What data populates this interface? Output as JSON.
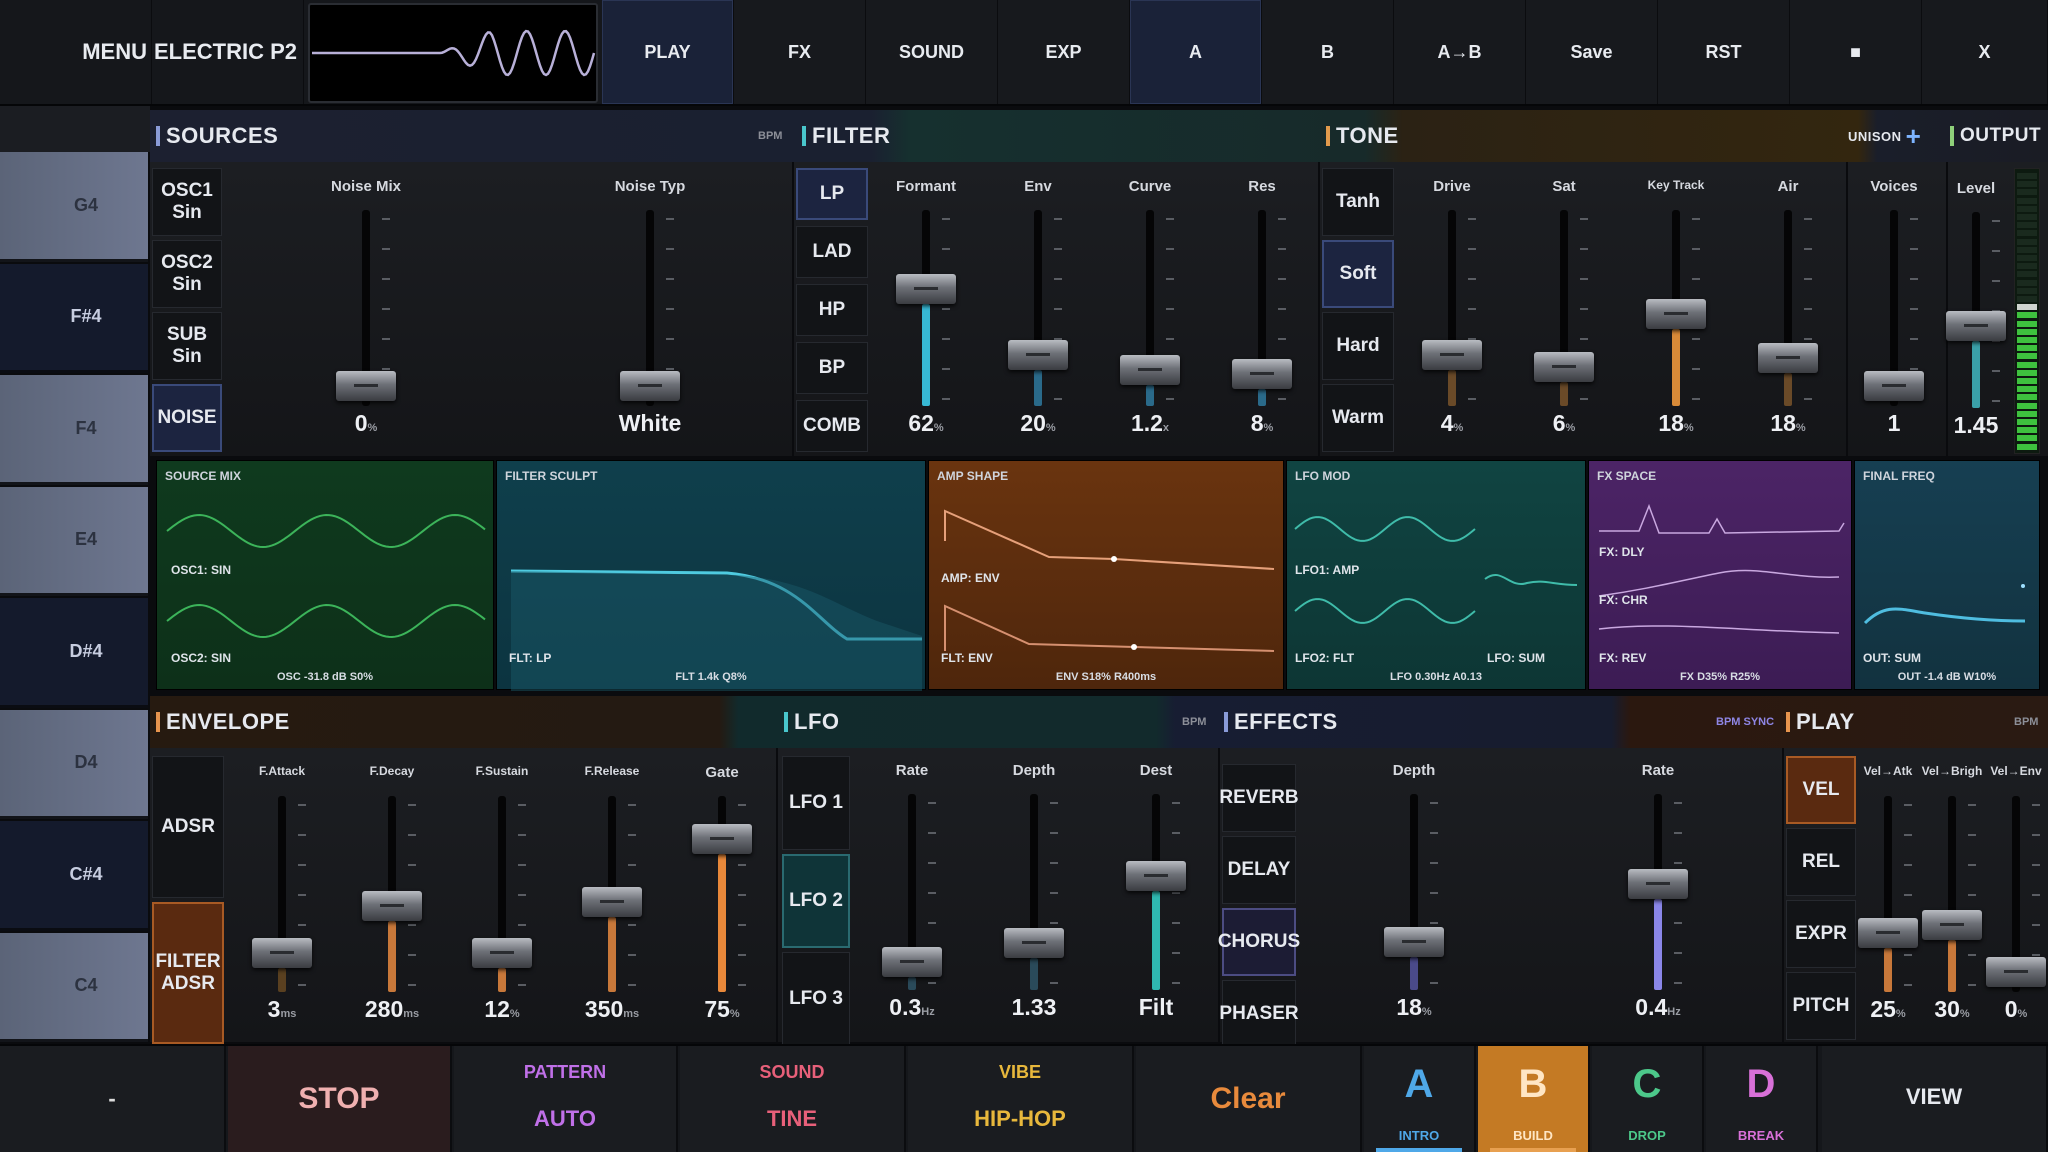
{
  "topbar": {
    "menu": "MENU",
    "preset": "ELECTRIC P2",
    "buttons": [
      "PLAY",
      "FX",
      "SOUND",
      "EXP",
      "A",
      "B",
      "A→B",
      "Save",
      "RST",
      "■",
      "X"
    ]
  },
  "keys": [
    "G4",
    "F#4",
    "F4",
    "E4",
    "D#4",
    "D4",
    "C#4",
    "C4"
  ],
  "sources": {
    "title": "SOURCES",
    "tag": "BPM",
    "buttons": [
      "OSC1 Sin",
      "OSC2 Sin",
      "SUB Sin",
      "NOISE"
    ],
    "sliders": [
      {
        "label": "Noise Mix",
        "value": "0",
        "unit": "%",
        "level": 0
      },
      {
        "label": "Noise Typ",
        "value": "White",
        "unit": "",
        "level": 0
      }
    ]
  },
  "filter": {
    "title": "FILTER",
    "modes": [
      "LP",
      "LAD",
      "HP",
      "BP",
      "COMB"
    ],
    "sliders": [
      {
        "label": "Formant",
        "value": "62",
        "unit": "%",
        "level": 0.62
      },
      {
        "label": "Env",
        "value": "20",
        "unit": "%",
        "level": 0.2
      },
      {
        "label": "Curve",
        "value": "1.2",
        "unit": "x",
        "level": 0.1
      },
      {
        "label": "Res",
        "value": "8",
        "unit": "%",
        "level": 0.08
      }
    ]
  },
  "tone": {
    "title": "TONE",
    "modes": [
      "Tanh",
      "Soft",
      "Hard",
      "Warm"
    ],
    "sliders": [
      {
        "label": "Drive",
        "value": "4",
        "unit": "%",
        "level": 0.2
      },
      {
        "label": "Sat",
        "value": "6",
        "unit": "%",
        "level": 0.12
      },
      {
        "label": "Key Track",
        "value": "18",
        "unit": "%",
        "level": 0.46
      },
      {
        "label": "Air",
        "value": "18",
        "unit": "%",
        "level": 0.18
      }
    ]
  },
  "unison": {
    "title": "UNISON",
    "voices": {
      "label": "Voices",
      "value": "1",
      "level": 0
    }
  },
  "output": {
    "title": "OUTPUT",
    "level": {
      "label": "Level",
      "value": "1.45",
      "level": 0.4
    }
  },
  "viz": {
    "source": {
      "title": "SOURCE MIX",
      "l1": "OSC1: SIN",
      "l2": "OSC2: SIN",
      "foot": "OSC -31.8 dB S0%"
    },
    "filter": {
      "title": "FILTER SCULPT",
      "l1": "FLT: LP",
      "foot": "FLT 1.4k Q8%"
    },
    "amp": {
      "title": "AMP SHAPE",
      "l1": "AMP: ENV",
      "l2": "FLT: ENV",
      "foot": "ENV S18% R400ms"
    },
    "lfo": {
      "title": "LFO MOD",
      "l1": "LFO1: AMP",
      "l2": "LFO2: FLT",
      "l3": "LFO: SUM",
      "foot": "LFO 0.30Hz A0.13"
    },
    "fx": {
      "title": "FX SPACE",
      "l1": "FX: DLY",
      "l2": "FX: CHR",
      "l3": "FX: REV",
      "foot": "FX D35% R25%"
    },
    "final": {
      "title": "FINAL FREQ",
      "l1": "OUT: SUM",
      "foot": "OUT -1.4 dB W10%"
    }
  },
  "envelope": {
    "title": "ENVELOPE",
    "modes": [
      "ADSR",
      "FILTER ADSR"
    ],
    "sliders": [
      {
        "label": "F.Attack",
        "value": "3",
        "unit": "ms",
        "level": 0.12
      },
      {
        "label": "F.Decay",
        "value": "280",
        "unit": "ms",
        "level": 0.42
      },
      {
        "label": "F.Sustain",
        "value": "12",
        "unit": "%",
        "level": 0.12
      },
      {
        "label": "F.Release",
        "value": "350",
        "unit": "ms",
        "level": 0.45
      },
      {
        "label": "Gate",
        "value": "75",
        "unit": "%",
        "level": 0.85
      }
    ]
  },
  "lfo": {
    "title": "LFO",
    "tag": "BPM",
    "modes": [
      "LFO 1",
      "LFO 2",
      "LFO 3"
    ],
    "sliders": [
      {
        "label": "Rate",
        "value": "0.3",
        "unit": "Hz",
        "level": 0.05
      },
      {
        "label": "Depth",
        "value": "1.33",
        "unit": "",
        "level": 0.17
      },
      {
        "label": "Dest",
        "value": "Filt",
        "unit": "",
        "level": 0.6
      }
    ]
  },
  "effects": {
    "title": "EFFECTS",
    "tag": "BPM SYNC",
    "modes": [
      "REVERB",
      "DELAY",
      "CHORUS",
      "PHASER"
    ],
    "sliders": [
      {
        "label": "Depth",
        "value": "18",
        "unit": "%",
        "level": 0.18
      },
      {
        "label": "Rate",
        "value": "0.4",
        "unit": "Hz",
        "level": 0.55
      }
    ]
  },
  "play": {
    "title": "PLAY",
    "tag": "BPM",
    "modes": [
      "VEL",
      "REL",
      "EXPR",
      "PITCH"
    ],
    "sliders": [
      {
        "label": "Vel→Atk",
        "value": "25",
        "unit": "%",
        "level": 0.25
      },
      {
        "label": "Vel→Brigh",
        "value": "30",
        "unit": "%",
        "level": 0.3
      },
      {
        "label": "Vel→Env",
        "value": "0",
        "unit": "%",
        "level": 0
      }
    ]
  },
  "bottom": {
    "minus": "-",
    "stop": "STOP",
    "pattern_top": "PATTERN",
    "pattern": "AUTO",
    "sound_top": "SOUND",
    "sound": "TINE",
    "vibe_top": "VIBE",
    "vibe": "HIP-HOP",
    "clear": "Clear",
    "view": "VIEW",
    "scenes": [
      {
        "letter": "A",
        "name": "INTRO"
      },
      {
        "letter": "B",
        "name": "BUILD"
      },
      {
        "letter": "C",
        "name": "DROP"
      },
      {
        "letter": "D",
        "name": "BREAK"
      }
    ]
  }
}
